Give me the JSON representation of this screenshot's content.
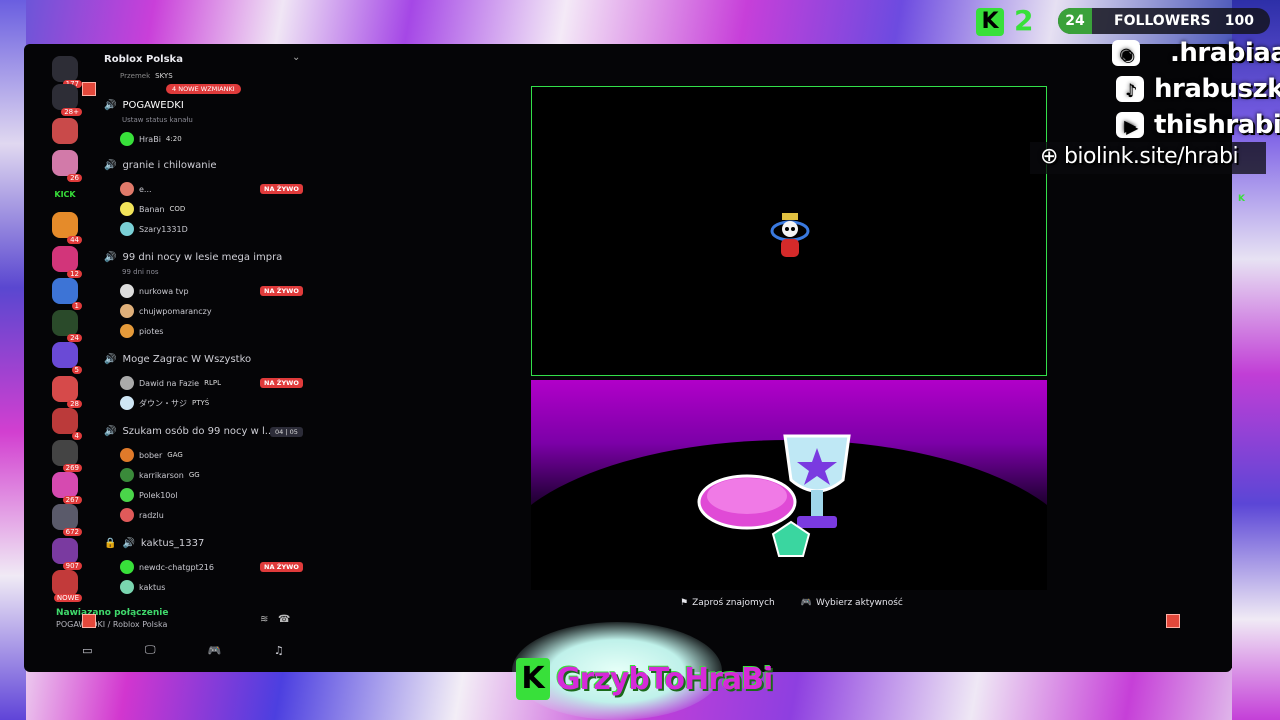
{
  "colors": {
    "accent_green": "#38e03a",
    "live_red": "#e03b3b",
    "stage_border": "#33e04a",
    "promo_purple": "#b100c9"
  },
  "rail": {
    "badges": [
      "177",
      "28+",
      "",
      "26",
      "",
      "44",
      "12",
      "1",
      "24",
      "5",
      "28",
      "4",
      "269",
      "267",
      "672",
      "907",
      "NOWE"
    ],
    "kick_label": "KICK"
  },
  "server": {
    "name": "Roblox Polska"
  },
  "channels": {
    "partial_user": "Przemek",
    "partial_tag": "SKYS",
    "mention_badge": "4 NOWE WZMIANKI",
    "c1": {
      "name": "POGAWEDKI",
      "status": "Ustaw status kanału",
      "users": [
        {
          "name": "HraBi",
          "tag": "4:20"
        }
      ]
    },
    "c2": {
      "name": "granie i chilowanie",
      "users": [
        {
          "name": "e...",
          "live": "NA ŻYWO"
        },
        {
          "name": "Banan",
          "tag": "COD"
        },
        {
          "name": "Szary1331D"
        }
      ]
    },
    "c3": {
      "name": "99 dni nocy w lesie mega impra",
      "sub": "99 dni nos",
      "users": [
        {
          "name": "nurkowa tvp",
          "live": "NA ŻYWO"
        },
        {
          "name": "chujwpomaranczy"
        },
        {
          "name": "piotes"
        }
      ]
    },
    "c4": {
      "name": "Moge Zagrac W Wszystko",
      "users": [
        {
          "name": "Dawid na Fazie",
          "tag": "RLPL",
          "live": "NA ŻYWO"
        },
        {
          "name": "ダウン・サジ",
          "tag": "PTYŚ"
        }
      ]
    },
    "c5": {
      "name": "Szukam osób do 99 nocy w l...",
      "count_a": "04",
      "count_b": "05",
      "users": [
        {
          "name": "bober",
          "tag": "GAG"
        },
        {
          "name": "karrikarson",
          "tag": "GG"
        },
        {
          "name": "Polek10ol"
        },
        {
          "name": "radzlu"
        }
      ]
    },
    "c6": {
      "name": "kaktus_1337",
      "users": [
        {
          "name": "newdc-chatgpt216",
          "live": "NA ŻYWO"
        },
        {
          "name": "kaktus"
        }
      ]
    }
  },
  "voice": {
    "status": "Nawiązano połączenie",
    "location": "POGAWEDKI / Roblox Polska"
  },
  "actions": {
    "invite": "Zaproś znajomych",
    "activity": "Wybierz aktywność"
  },
  "overlay": {
    "k_count": "2",
    "followers_now": "24",
    "followers_label": "FOLLOWERS",
    "followers_goal": "100",
    "discord": ".hrabiaa",
    "tiktok": "hrabuszka",
    "youtube": "thishrabia",
    "biolink": "biolink.site/hrabi",
    "nametag": "GrzybToHraBi",
    "k_letter": "K"
  }
}
